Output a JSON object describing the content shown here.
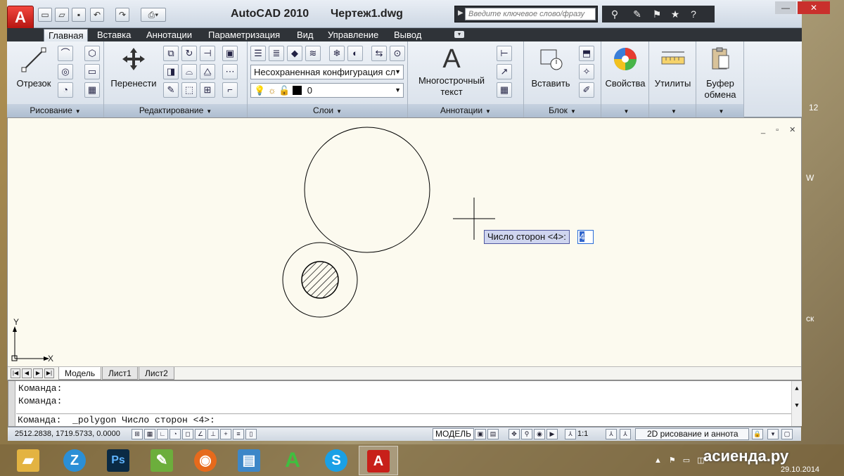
{
  "titlebar": {
    "app_title": "AutoCAD 2010",
    "doc_title": "Чертеж1.dwg",
    "search_placeholder": "Введите ключевое слово/фразу",
    "win_minimize": "—",
    "win_close": "✕"
  },
  "ribbon_tabs": [
    "Главная",
    "Вставка",
    "Аннотации",
    "Параметризация",
    "Вид",
    "Управление",
    "Вывод"
  ],
  "ribbon": {
    "draw": {
      "title": "Рисование",
      "big_label": "Отрезок"
    },
    "modify": {
      "title": "Редактирование",
      "big_label": "Перенести"
    },
    "layers": {
      "title": "Слои",
      "state_combo": "Несохраненная конфигурация сл",
      "layer_combo": "0"
    },
    "annotation": {
      "title": "Аннотации",
      "big_label_1": "Многострочный",
      "big_label_2": "текст"
    },
    "block": {
      "title": "Блок",
      "big_label": "Вставить"
    },
    "properties": {
      "label": "Свойства"
    },
    "utilities": {
      "label": "Утилиты"
    },
    "clipboard": {
      "label_1": "Буфер",
      "label_2": "обмена"
    }
  },
  "drawing": {
    "tooltip_prompt": "Число сторон <4>:",
    "tooltip_value": "4",
    "ucs_x": "X",
    "ucs_y": "Y",
    "viewport_controls": "_ ▫ ✕"
  },
  "layout_tabs": [
    "Модель",
    "Лист1",
    "Лист2"
  ],
  "command": {
    "history": [
      "Команда:",
      "Команда:"
    ],
    "input": "Команда:  _polygon Число сторон <4>:"
  },
  "status": {
    "coords": "2512.2838, 1719.5733, 0.0000",
    "model": "МОДЕЛЬ",
    "scale": "1:1",
    "workspace": "2D рисование и аннота"
  },
  "taskbar": {
    "date": "29.10.2014",
    "watermark": "асиенда.ру"
  },
  "desktop_text": [
    "12",
    "W",
    "ск"
  ]
}
